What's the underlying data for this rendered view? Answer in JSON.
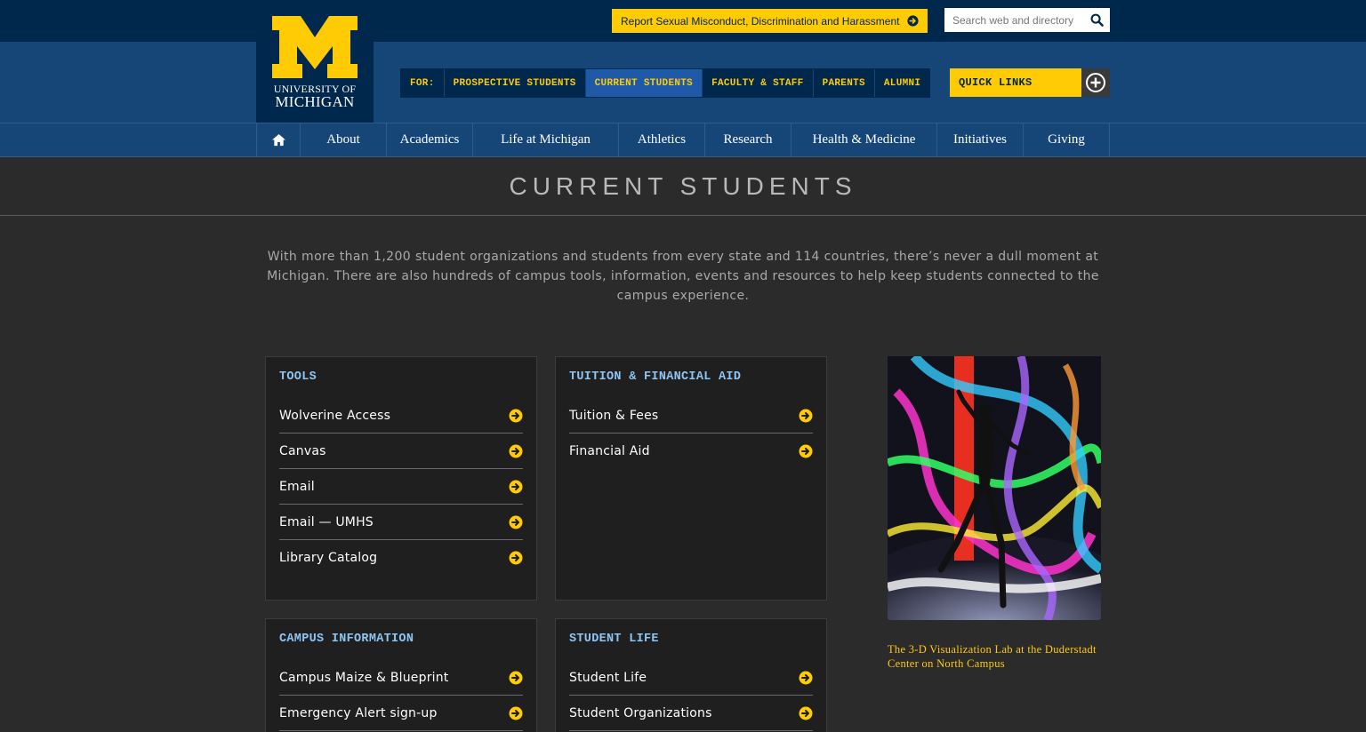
{
  "logo": {
    "line1": "UNIVERSITY OF",
    "line2": "MICHIGAN"
  },
  "utility": {
    "report_label": "Report Sexual Misconduct, Discrimination and Harassment",
    "search_placeholder": "Search web and directory"
  },
  "audience": {
    "for_label": "FOR:",
    "items": [
      {
        "label": "PROSPECTIVE STUDENTS",
        "active": false
      },
      {
        "label": "CURRENT STUDENTS",
        "active": true
      },
      {
        "label": "FACULTY & STAFF",
        "active": false
      },
      {
        "label": "PARENTS",
        "active": false
      },
      {
        "label": "ALUMNI",
        "active": false
      }
    ]
  },
  "quick_links_label": "QUICK LINKS",
  "nav": {
    "home_icon": "home-icon",
    "items": [
      "About",
      "Academics",
      "Life at Michigan",
      "Athletics",
      "Research",
      "Health & Medicine",
      "Initiatives",
      "Giving"
    ]
  },
  "page": {
    "title": "CURRENT STUDENTS",
    "intro": "With more than 1,200 student organizations and students from every state and 114 countries, there’s never a dull moment at Michigan. There are also hundreds of campus tools, information, events and resources to help keep students connected to the campus experience."
  },
  "cards": [
    {
      "title": "TOOLS",
      "items": [
        "Wolverine Access",
        "Canvas",
        "Email",
        "Email — UMHS",
        "Library Catalog"
      ]
    },
    {
      "title": "TUITION & FINANCIAL AID",
      "items": [
        "Tuition & Fees",
        "Financial Aid"
      ]
    },
    {
      "title": "CAMPUS INFORMATION",
      "items": [
        "Campus Maize & Blueprint",
        "Emergency Alert sign-up"
      ]
    },
    {
      "title": "STUDENT LIFE",
      "items": [
        "Student Life",
        "Student Organizations"
      ]
    }
  ],
  "feature": {
    "caption": "The 3-D Visualization Lab at the Duderstadt Center on North Campus"
  },
  "colors": {
    "maize": "#ffcb05",
    "blue": "#00274c",
    "band_blue": "#164577",
    "active_tab": "#1e5aa8",
    "card_title": "#8ec5f2",
    "page_bg": "#2b2b2b"
  }
}
